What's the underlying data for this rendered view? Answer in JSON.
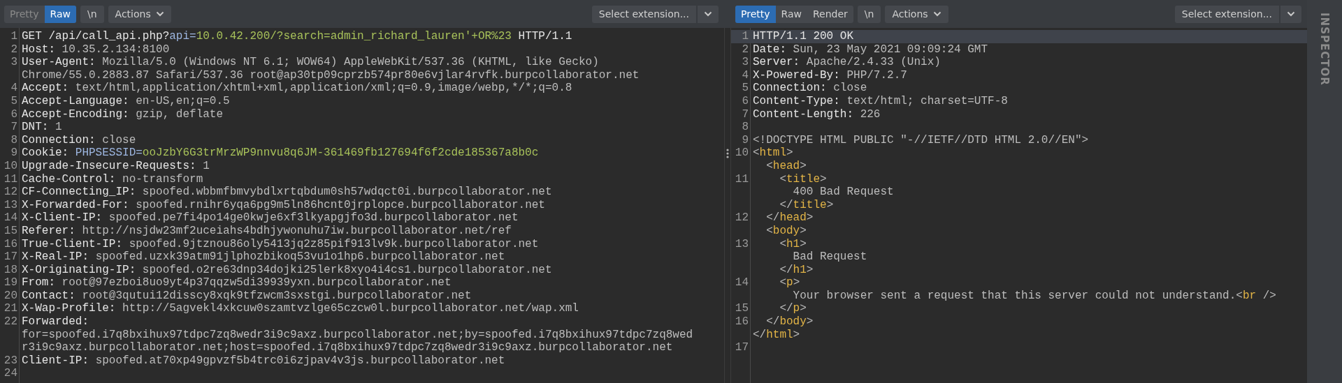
{
  "request": {
    "toolbar": {
      "view_tabs": [
        {
          "label": "Pretty",
          "selected": false
        },
        {
          "label": "Raw",
          "selected": true
        }
      ],
      "newline_button": "\\n",
      "actions_button": "Actions",
      "extension_select": "Select extension..."
    },
    "lines": [
      {
        "number": "1",
        "current": false,
        "rows": [
          {
            "tokens": [
              {
                "kind": "name",
                "text": "GET /api/call_api.php?"
              },
              {
                "kind": "param",
                "text": "api="
              },
              {
                "kind": "param_value",
                "text": "10.0.42.200/?search=admin_richard_lauren'+OR%23"
              },
              {
                "kind": "name",
                "text": " HTTP/1.1"
              }
            ]
          }
        ]
      },
      {
        "number": "2",
        "current": false,
        "rows": [
          {
            "tokens": [
              {
                "kind": "name",
                "text": "Host: "
              },
              {
                "kind": "value",
                "text": "10.35.2.134:8100"
              }
            ]
          }
        ]
      },
      {
        "number": "3",
        "current": false,
        "rows": [
          {
            "tokens": [
              {
                "kind": "name",
                "text": "User-Agent: "
              },
              {
                "kind": "value",
                "text": "Mozilla/5.0 (Windows NT 6.1; WOW64) AppleWebKit/537.36 (KHTML, like Gecko)"
              }
            ]
          },
          {
            "tokens": [
              {
                "kind": "value",
                "text": "Chrome/55.0.2883.87 Safari/537.36 root@ap30tp09cprzb574pr80e6vjlar4rvfk.burpcollaborator.net"
              }
            ]
          }
        ]
      },
      {
        "number": "4",
        "current": false,
        "rows": [
          {
            "tokens": [
              {
                "kind": "name",
                "text": "Accept: "
              },
              {
                "kind": "value",
                "text": "text/html,application/xhtml+xml,application/xml;q=0.9,image/webp,*/*;q=0.8"
              }
            ]
          }
        ]
      },
      {
        "number": "5",
        "current": false,
        "rows": [
          {
            "tokens": [
              {
                "kind": "name",
                "text": "Accept-Language: "
              },
              {
                "kind": "value",
                "text": "en-US,en;q=0.5"
              }
            ]
          }
        ]
      },
      {
        "number": "6",
        "current": false,
        "rows": [
          {
            "tokens": [
              {
                "kind": "name",
                "text": "Accept-Encoding: "
              },
              {
                "kind": "value",
                "text": "gzip, deflate"
              }
            ]
          }
        ]
      },
      {
        "number": "7",
        "current": false,
        "rows": [
          {
            "tokens": [
              {
                "kind": "name",
                "text": "DNT: "
              },
              {
                "kind": "value",
                "text": "1"
              }
            ]
          }
        ]
      },
      {
        "number": "8",
        "current": false,
        "rows": [
          {
            "tokens": [
              {
                "kind": "name",
                "text": "Connection: "
              },
              {
                "kind": "value",
                "text": "close"
              }
            ]
          }
        ]
      },
      {
        "number": "9",
        "current": false,
        "rows": [
          {
            "tokens": [
              {
                "kind": "name",
                "text": "Cookie: "
              },
              {
                "kind": "param",
                "text": "PHPSESSID="
              },
              {
                "kind": "param_value",
                "text": "ooJzbY6G3trMrzWP9nnvu8q6JM-361469fb127694f6f2cde185367a8b0c"
              }
            ]
          }
        ]
      },
      {
        "number": "10",
        "current": false,
        "rows": [
          {
            "tokens": [
              {
                "kind": "name",
                "text": "Upgrade-Insecure-Requests: "
              },
              {
                "kind": "value",
                "text": "1"
              }
            ]
          }
        ]
      },
      {
        "number": "11",
        "current": false,
        "rows": [
          {
            "tokens": [
              {
                "kind": "name",
                "text": "Cache-Control: "
              },
              {
                "kind": "value",
                "text": "no-transform"
              }
            ]
          }
        ]
      },
      {
        "number": "12",
        "current": false,
        "rows": [
          {
            "tokens": [
              {
                "kind": "name",
                "text": "CF-Connecting_IP: "
              },
              {
                "kind": "value",
                "text": "spoofed.wbbmfbmvybdlxrtqbdum0sh57wdqct0i.burpcollaborator.net"
              }
            ]
          }
        ]
      },
      {
        "number": "13",
        "current": false,
        "rows": [
          {
            "tokens": [
              {
                "kind": "name",
                "text": "X-Forwarded-For: "
              },
              {
                "kind": "value",
                "text": "spoofed.rnihr6yqa6pg9m5ln86hcnt0jrplopce.burpcollaborator.net"
              }
            ]
          }
        ]
      },
      {
        "number": "14",
        "current": false,
        "rows": [
          {
            "tokens": [
              {
                "kind": "name",
                "text": "X-Client-IP: "
              },
              {
                "kind": "value",
                "text": "spoofed.pe7fi4po14ge0kwje6xf3lkyapgjfo3d.burpcollaborator.net"
              }
            ]
          }
        ]
      },
      {
        "number": "15",
        "current": false,
        "rows": [
          {
            "tokens": [
              {
                "kind": "name",
                "text": "Referer: "
              },
              {
                "kind": "value",
                "text": "http://nsjdw23mf2uceiahs4bdhjywonuhu7iw.burpcollaborator.net/ref"
              }
            ]
          }
        ]
      },
      {
        "number": "16",
        "current": false,
        "rows": [
          {
            "tokens": [
              {
                "kind": "name",
                "text": "True-Client-IP: "
              },
              {
                "kind": "value",
                "text": "spoofed.9jtznou86oly5413jq2z85pif913lv9k.burpcollaborator.net"
              }
            ]
          }
        ]
      },
      {
        "number": "17",
        "current": false,
        "rows": [
          {
            "tokens": [
              {
                "kind": "name",
                "text": "X-Real-IP: "
              },
              {
                "kind": "value",
                "text": "spoofed.uzxk39atm91jlphozbikoq53vu1o1hp6.burpcollaborator.net"
              }
            ]
          }
        ]
      },
      {
        "number": "18",
        "current": false,
        "rows": [
          {
            "tokens": [
              {
                "kind": "name",
                "text": "X-Originating-IP: "
              },
              {
                "kind": "value",
                "text": "spoofed.o2re63dnp34dojki25lerk8xyo4i4cs1.burpcollaborator.net"
              }
            ]
          }
        ]
      },
      {
        "number": "19",
        "current": false,
        "rows": [
          {
            "tokens": [
              {
                "kind": "name",
                "text": "From: "
              },
              {
                "kind": "value",
                "text": "root@97ezboi8uo9yt4p37qqzw5di39939yxn.burpcollaborator.net"
              }
            ]
          }
        ]
      },
      {
        "number": "20",
        "current": false,
        "rows": [
          {
            "tokens": [
              {
                "kind": "name",
                "text": "Contact: "
              },
              {
                "kind": "value",
                "text": "root@3qutui12disscy8xqk9tfzwcm3sxstgi.burpcollaborator.net"
              }
            ]
          }
        ]
      },
      {
        "number": "21",
        "current": false,
        "rows": [
          {
            "tokens": [
              {
                "kind": "name",
                "text": "X-Wap-Profile: "
              },
              {
                "kind": "value",
                "text": "http://5agvekl4xkcuw0szamtvzlge65czcw0l.burpcollaborator.net/wap.xml"
              }
            ]
          }
        ]
      },
      {
        "number": "22",
        "current": false,
        "rows": [
          {
            "tokens": [
              {
                "kind": "name",
                "text": "Forwarded:"
              }
            ]
          },
          {
            "tokens": [
              {
                "kind": "value",
                "text": "for=spoofed.i7q8bxihux97tdpc7zq8wedr3i9c9axz.burpcollaborator.net;by=spoofed.i7q8bxihux97tdpc7zq8wed"
              }
            ]
          },
          {
            "tokens": [
              {
                "kind": "value",
                "text": "r3i9c9axz.burpcollaborator.net;host=spoofed.i7q8bxihux97tdpc7zq8wedr3i9c9axz.burpcollaborator.net"
              }
            ]
          }
        ]
      },
      {
        "number": "23",
        "current": false,
        "rows": [
          {
            "tokens": [
              {
                "kind": "name",
                "text": "Client-IP: "
              },
              {
                "kind": "value",
                "text": "spoofed.at70xp49gpvzf5b4trc0i6zjpav4v3js.burpcollaborator.net"
              }
            ]
          }
        ]
      },
      {
        "number": "24",
        "current": false,
        "rows": [
          {
            "tokens": []
          }
        ]
      }
    ]
  },
  "response": {
    "toolbar": {
      "view_tabs": [
        {
          "label": "Pretty",
          "selected": true
        },
        {
          "label": "Raw",
          "selected": false
        },
        {
          "label": "Render",
          "selected": false
        }
      ],
      "newline_button": "\\n",
      "actions_button": "Actions",
      "extension_select": "Select extension..."
    },
    "lines": [
      {
        "number": "1",
        "current": true,
        "rows": [
          {
            "tokens": [
              {
                "kind": "name",
                "text": "HTTP/1.1 200 OK"
              }
            ]
          }
        ]
      },
      {
        "number": "2",
        "current": false,
        "rows": [
          {
            "tokens": [
              {
                "kind": "name",
                "text": "Date: "
              },
              {
                "kind": "value",
                "text": "Sun, 23 May 2021 09:09:24 GMT"
              }
            ]
          }
        ]
      },
      {
        "number": "3",
        "current": false,
        "rows": [
          {
            "tokens": [
              {
                "kind": "name",
                "text": "Server: "
              },
              {
                "kind": "value",
                "text": "Apache/2.4.33 (Unix)"
              }
            ]
          }
        ]
      },
      {
        "number": "4",
        "current": false,
        "rows": [
          {
            "tokens": [
              {
                "kind": "name",
                "text": "X-Powered-By: "
              },
              {
                "kind": "value",
                "text": "PHP/7.2.7"
              }
            ]
          }
        ]
      },
      {
        "number": "5",
        "current": false,
        "rows": [
          {
            "tokens": [
              {
                "kind": "name",
                "text": "Connection: "
              },
              {
                "kind": "value",
                "text": "close"
              }
            ]
          }
        ]
      },
      {
        "number": "6",
        "current": false,
        "rows": [
          {
            "tokens": [
              {
                "kind": "name",
                "text": "Content-Type: "
              },
              {
                "kind": "value",
                "text": "text/html; charset=UTF-8"
              }
            ]
          }
        ]
      },
      {
        "number": "7",
        "current": false,
        "rows": [
          {
            "tokens": [
              {
                "kind": "name",
                "text": "Content-Length: "
              },
              {
                "kind": "value",
                "text": "226"
              }
            ]
          }
        ]
      },
      {
        "number": "8",
        "current": false,
        "rows": [
          {
            "tokens": []
          }
        ]
      },
      {
        "number": "9",
        "current": false,
        "rows": [
          {
            "tokens": [
              {
                "kind": "value",
                "text": "<!DOCTYPE HTML PUBLIC \"-//IETF//DTD HTML 2.0//EN\">"
              }
            ]
          }
        ]
      },
      {
        "number": "10",
        "current": false,
        "rows": [
          {
            "tokens": [
              {
                "kind": "value",
                "text": "<"
              },
              {
                "kind": "tag",
                "text": "html"
              },
              {
                "kind": "value",
                "text": ">"
              }
            ]
          },
          {
            "tokens": [
              {
                "kind": "value",
                "text": "  <"
              },
              {
                "kind": "tag",
                "text": "head"
              },
              {
                "kind": "value",
                "text": ">"
              }
            ]
          }
        ]
      },
      {
        "number": "11",
        "current": false,
        "rows": [
          {
            "tokens": [
              {
                "kind": "value",
                "text": "    <"
              },
              {
                "kind": "tag",
                "text": "title"
              },
              {
                "kind": "value",
                "text": ">"
              }
            ]
          },
          {
            "tokens": [
              {
                "kind": "value",
                "text": "      400 Bad Request"
              }
            ]
          },
          {
            "tokens": [
              {
                "kind": "value",
                "text": "    </"
              },
              {
                "kind": "tag",
                "text": "title"
              },
              {
                "kind": "value",
                "text": ">"
              }
            ]
          }
        ]
      },
      {
        "number": "12",
        "current": false,
        "rows": [
          {
            "tokens": [
              {
                "kind": "value",
                "text": "  </"
              },
              {
                "kind": "tag",
                "text": "head"
              },
              {
                "kind": "value",
                "text": ">"
              }
            ]
          },
          {
            "tokens": [
              {
                "kind": "value",
                "text": "  <"
              },
              {
                "kind": "tag",
                "text": "body"
              },
              {
                "kind": "value",
                "text": ">"
              }
            ]
          }
        ]
      },
      {
        "number": "13",
        "current": false,
        "rows": [
          {
            "tokens": [
              {
                "kind": "value",
                "text": "    <"
              },
              {
                "kind": "tag",
                "text": "h1"
              },
              {
                "kind": "value",
                "text": ">"
              }
            ]
          },
          {
            "tokens": [
              {
                "kind": "value",
                "text": "      Bad Request"
              }
            ]
          },
          {
            "tokens": [
              {
                "kind": "value",
                "text": "    </"
              },
              {
                "kind": "tag",
                "text": "h1"
              },
              {
                "kind": "value",
                "text": ">"
              }
            ]
          }
        ]
      },
      {
        "number": "14",
        "current": false,
        "rows": [
          {
            "tokens": [
              {
                "kind": "value",
                "text": "    <"
              },
              {
                "kind": "tag",
                "text": "p"
              },
              {
                "kind": "value",
                "text": ">"
              }
            ]
          },
          {
            "tokens": [
              {
                "kind": "value",
                "text": "      Your browser sent a request that this server could not understand.<"
              },
              {
                "kind": "tag",
                "text": "br"
              },
              {
                "kind": "value",
                "text": " />"
              }
            ]
          }
        ]
      },
      {
        "number": "15",
        "current": false,
        "rows": [
          {
            "tokens": [
              {
                "kind": "value",
                "text": "    </"
              },
              {
                "kind": "tag",
                "text": "p"
              },
              {
                "kind": "value",
                "text": ">"
              }
            ]
          }
        ]
      },
      {
        "number": "16",
        "current": false,
        "rows": [
          {
            "tokens": [
              {
                "kind": "value",
                "text": "  </"
              },
              {
                "kind": "tag",
                "text": "body"
              },
              {
                "kind": "value",
                "text": ">"
              }
            ]
          },
          {
            "tokens": [
              {
                "kind": "value",
                "text": "</"
              },
              {
                "kind": "tag",
                "text": "html"
              },
              {
                "kind": "value",
                "text": ">"
              }
            ]
          }
        ]
      },
      {
        "number": "17",
        "current": false,
        "rows": [
          {
            "tokens": []
          }
        ]
      }
    ]
  },
  "inspector": {
    "label": "INSPECTOR"
  }
}
